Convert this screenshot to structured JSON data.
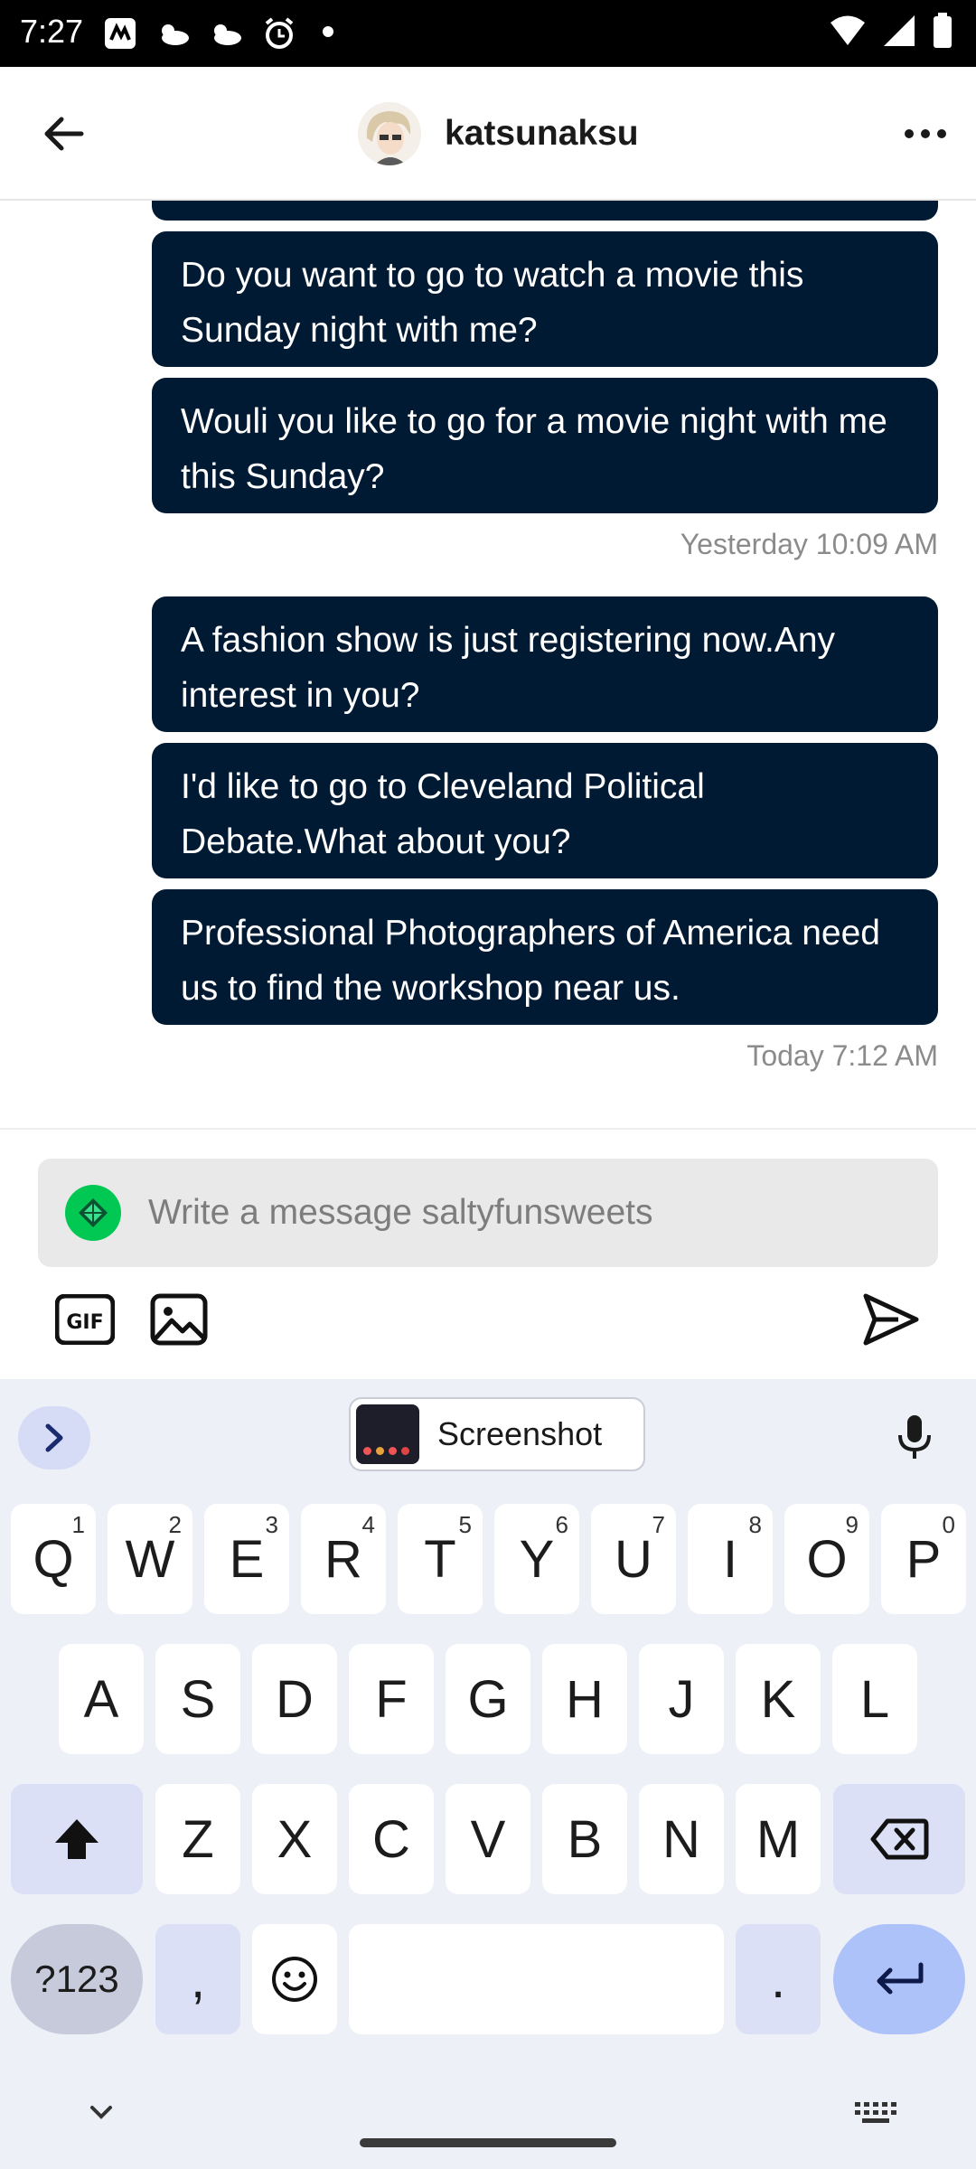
{
  "status_bar": {
    "time": "7:27"
  },
  "header": {
    "peer_name": "katsunaksu"
  },
  "messages": [
    {
      "text": "Do you want to go to watch a movie this Sunday night with me?"
    },
    {
      "text": "Wouli you like to go for a movie night with me this Sunday?"
    },
    {
      "timestamp": "Yesterday 10:09 AM"
    },
    {
      "text": "A fashion show is just registering now.Any interest in you?"
    },
    {
      "text": "I'd like to go to Cleveland Political Debate.What about you?"
    },
    {
      "text": "Professional Photographers of America need us to find the workshop near us."
    },
    {
      "timestamp": "Today 7:12 AM"
    }
  ],
  "composer": {
    "placeholder": "Write a message saltyfunsweets",
    "value": ""
  },
  "keyboard": {
    "clipboard_label": "Screenshot",
    "row1": [
      {
        "key": "Q",
        "hint": "1"
      },
      {
        "key": "W",
        "hint": "2"
      },
      {
        "key": "E",
        "hint": "3"
      },
      {
        "key": "R",
        "hint": "4"
      },
      {
        "key": "T",
        "hint": "5"
      },
      {
        "key": "Y",
        "hint": "6"
      },
      {
        "key": "U",
        "hint": "7"
      },
      {
        "key": "I",
        "hint": "8"
      },
      {
        "key": "O",
        "hint": "9"
      },
      {
        "key": "P",
        "hint": "0"
      }
    ],
    "row2": [
      "A",
      "S",
      "D",
      "F",
      "G",
      "H",
      "J",
      "K",
      "L"
    ],
    "row3": [
      "Z",
      "X",
      "C",
      "V",
      "B",
      "N",
      "M"
    ],
    "symbols_label": "?123",
    "comma": ",",
    "period": "."
  },
  "colors": {
    "bubble": "#011a33",
    "accent_green": "#00c853",
    "keyboard_bg": "#eef0f8",
    "enter_key": "#adc2f9"
  },
  "icons": {
    "back": "arrow-left-icon",
    "more": "more-horizontal-icon",
    "gif": "gif-icon",
    "image": "image-icon",
    "send": "send-icon",
    "mic": "microphone-icon",
    "shift": "shift-icon",
    "backspace": "backspace-icon",
    "emoji": "emoji-icon",
    "enter": "enter-icon"
  }
}
